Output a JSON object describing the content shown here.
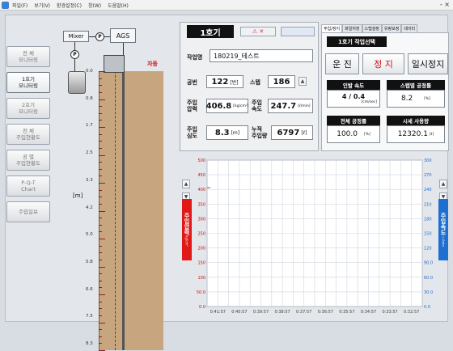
{
  "menu": {
    "items": [
      "파일(F)",
      "보기(V)",
      "환경설정(C)",
      "창(W)",
      "도움말(H)"
    ],
    "window_controls": "- ×"
  },
  "sidebar": {
    "items": [
      {
        "label": "전    체\n모니터링",
        "active": false
      },
      {
        "label": "1호기\n모니터링",
        "active": true
      },
      {
        "label": "2호기\n모니터링",
        "active": false
      },
      {
        "label": "전    체\n주입현황도",
        "active": false
      },
      {
        "label": "공    별\n주입현황도",
        "active": false
      },
      {
        "label": "P-Q-T\nChart",
        "active": false
      },
      {
        "label": "주입일보",
        "active": false
      }
    ]
  },
  "schematic": {
    "mixer": "Mixer",
    "ags": "AGS",
    "p": "P",
    "auto": "자동",
    "unit": "[m]",
    "depth_marks": [
      "0.0",
      "0.8",
      "1.7",
      "2.5",
      "3.3",
      "4.2",
      "5.0",
      "5.8",
      "6.6",
      "7.5",
      "8.3"
    ]
  },
  "machine": {
    "title": "1호기",
    "work_name_label": "작업명",
    "work_name": "180219_테스트",
    "hole_label": "공번",
    "hole_value": "122",
    "hole_unit": "[번]",
    "step_label": "스텝",
    "step_value": "186",
    "pressure_label": "주입\n압력",
    "pressure_value": "406.8",
    "pressure_unit": "[kg/cm²]",
    "speed_label": "주입\n속도",
    "speed_value": "247.7",
    "speed_unit": "[ℓ/min]",
    "depth_label": "주입\n심도",
    "depth_value": "8.3",
    "depth_unit": "[m]",
    "total_label": "누적\n주입량",
    "total_value": "6797",
    "total_unit": "[ℓ]"
  },
  "tabs": [
    "주입/정지",
    "파일저장",
    "스텝설정",
    "유량보정",
    "데이터"
  ],
  "control": {
    "machine_select": "1호기 작업선택",
    "run": "운 진",
    "stop": "정 지",
    "pause": "일시정지",
    "pull_speed_label": "인발 속도",
    "pull_speed_value": "4 / 0.4",
    "pull_speed_unit": "[cm/sec]",
    "step_ratio_label": "스텝별 공정률",
    "step_ratio_value": "8.2",
    "step_ratio_unit": "[%]",
    "total_ratio_label": "전체 공정률",
    "total_ratio_value": "100.0",
    "total_ratio_unit": "[%]",
    "usage_label": "시세 사용량",
    "usage_value": "12320.1",
    "usage_unit": "[ℓ]"
  },
  "chart_data": {
    "type": "line",
    "left_axis_label": "주입압력",
    "left_axis_unit": "kg/cm²",
    "right_axis_label": "주입속도",
    "right_axis_unit": "ℓ/min",
    "left_ticks": [
      "500",
      "450",
      "400",
      "350",
      "300",
      "250",
      "200",
      "150",
      "100",
      "50.0",
      "0.0"
    ],
    "right_ticks": [
      "300",
      "270",
      "240",
      "210",
      "180",
      "150",
      "120",
      "90.0",
      "60.0",
      "30.0",
      "0.0"
    ],
    "x_ticks": [
      "0:41:57",
      "0:40:57",
      "0:39:57",
      "0:38:57",
      "0:37:57",
      "0:36:57",
      "0:35:57",
      "0:34:57",
      "0:33:57",
      "0:32:57"
    ],
    "ylim_left": [
      0,
      500
    ],
    "ylim_right": [
      0,
      300
    ],
    "grid": true,
    "series": []
  },
  "colors": {
    "accent_red": "#d01010",
    "left_axis_bg": "#e01818",
    "right_axis_bg": "#1f6fd0"
  }
}
